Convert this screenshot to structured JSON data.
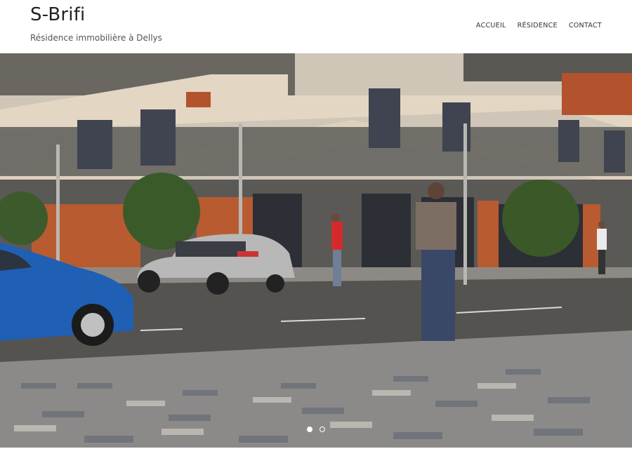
{
  "site": {
    "title": "S-Brifi",
    "tagline": "Résidence immobilière à Dellys"
  },
  "nav": {
    "items": [
      {
        "label": "ACCUEIL"
      },
      {
        "label": "RÉSIDENCE"
      },
      {
        "label": "CONTACT"
      }
    ]
  },
  "slider": {
    "slide_count": 2,
    "active_index": 0,
    "image_description_icon": "building-render-image"
  }
}
